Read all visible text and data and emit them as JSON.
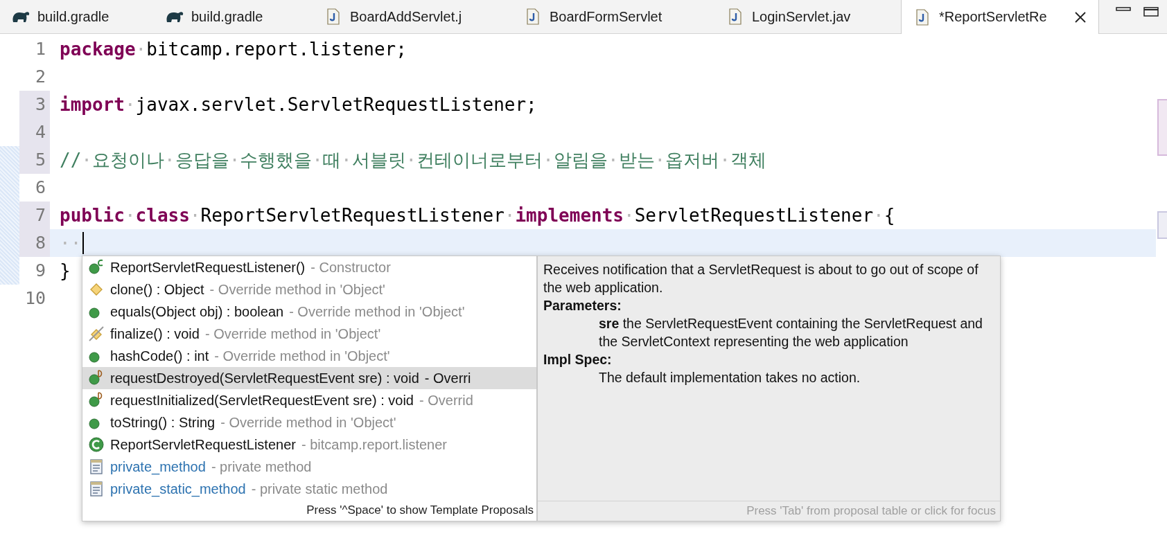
{
  "tabs": [
    {
      "label": "build.gradle",
      "kind": "gradle",
      "selected": false
    },
    {
      "label": "build.gradle",
      "kind": "gradle",
      "selected": false
    },
    {
      "label": "BoardAddServlet.j",
      "kind": "java",
      "selected": false
    },
    {
      "label": "BoardFormServlet",
      "kind": "java",
      "selected": false
    },
    {
      "label": "LoginServlet.jav",
      "kind": "java",
      "selected": false
    },
    {
      "label": "*ReportServletRe",
      "kind": "java",
      "selected": true
    }
  ],
  "editor": {
    "lines": [
      {
        "number": "1",
        "changed": false,
        "tokens": [
          {
            "kind": "keyword",
            "text": "package"
          },
          {
            "kind": "space",
            "text": "·"
          },
          {
            "kind": "plain",
            "text": "bitcamp.report.listener;"
          }
        ]
      },
      {
        "number": "2",
        "changed": false
      },
      {
        "number": "3",
        "changed": true,
        "tokens": [
          {
            "kind": "keyword",
            "text": "import"
          },
          {
            "kind": "space",
            "text": "·"
          },
          {
            "kind": "plain",
            "text": "javax.servlet.ServletRequestListener;"
          }
        ]
      },
      {
        "number": "4",
        "changed": true
      },
      {
        "number": "5",
        "changed": true,
        "tokens": [
          {
            "kind": "comment",
            "text": "//"
          },
          {
            "kind": "space",
            "text": "·"
          },
          {
            "kind": "comment",
            "text": "요청이나"
          },
          {
            "kind": "space",
            "text": "·"
          },
          {
            "kind": "comment",
            "text": "응답을"
          },
          {
            "kind": "space",
            "text": "·"
          },
          {
            "kind": "comment",
            "text": "수행했을"
          },
          {
            "kind": "space",
            "text": "·"
          },
          {
            "kind": "comment",
            "text": "때"
          },
          {
            "kind": "space",
            "text": "·"
          },
          {
            "kind": "comment",
            "text": "서블릿"
          },
          {
            "kind": "space",
            "text": "·"
          },
          {
            "kind": "comment",
            "text": "컨테이너로부터"
          },
          {
            "kind": "space",
            "text": "·"
          },
          {
            "kind": "comment",
            "text": "알림을"
          },
          {
            "kind": "space",
            "text": "·"
          },
          {
            "kind": "comment",
            "text": "받는"
          },
          {
            "kind": "space",
            "text": "·"
          },
          {
            "kind": "comment",
            "text": "옵저버"
          },
          {
            "kind": "space",
            "text": "·"
          },
          {
            "kind": "comment",
            "text": "객체"
          }
        ]
      },
      {
        "number": "6",
        "changed": false
      },
      {
        "number": "7",
        "changed": true,
        "tokens": [
          {
            "kind": "keyword",
            "text": "public"
          },
          {
            "kind": "space",
            "text": "·"
          },
          {
            "kind": "keyword",
            "text": "class"
          },
          {
            "kind": "space",
            "text": "·"
          },
          {
            "kind": "plain",
            "text": "ReportServletRequestListener"
          },
          {
            "kind": "space",
            "text": "·"
          },
          {
            "kind": "keyword",
            "text": "implements"
          },
          {
            "kind": "space",
            "text": "·"
          },
          {
            "kind": "plain",
            "text": "ServletRequestListener"
          },
          {
            "kind": "space",
            "text": "·"
          },
          {
            "kind": "plain",
            "text": "{"
          }
        ]
      },
      {
        "number": "8",
        "changed": true,
        "current": true,
        "tokens": [
          {
            "kind": "space",
            "text": "··"
          }
        ]
      },
      {
        "number": "9",
        "changed": false,
        "tokens": [
          {
            "kind": "plain",
            "text": "}"
          }
        ]
      },
      {
        "number": "10",
        "changed": false
      }
    ]
  },
  "completion": {
    "proposals": [
      {
        "kind": "constructor",
        "name": "ReportServletRequestListener()",
        "detail": "- Constructor",
        "selected": false
      },
      {
        "kind": "default",
        "name": "clone() : Object",
        "detail": "- Override method in 'Object'",
        "selected": false
      },
      {
        "kind": "method",
        "name": "equals(Object obj) : boolean",
        "detail": "- Override method in 'Object'",
        "selected": false
      },
      {
        "kind": "deprecated",
        "name": "finalize() : void",
        "detail": "- Override method in 'Object'",
        "selected": false
      },
      {
        "kind": "method",
        "name": "hashCode() : int",
        "detail": "- Override method in 'Object'",
        "selected": false
      },
      {
        "kind": "default-method",
        "name": "requestDestroyed(ServletRequestEvent sre) : void",
        "detail": "- Overri",
        "selected": true
      },
      {
        "kind": "default-method",
        "name": "requestInitialized(ServletRequestEvent sre) : void",
        "detail": "- Overrid",
        "selected": false
      },
      {
        "kind": "method",
        "name": "toString() : String",
        "detail": "- Override method in 'Object'",
        "selected": false
      },
      {
        "kind": "class",
        "name": "ReportServletRequestListener",
        "detail": "- bitcamp.report.listener",
        "selected": false
      },
      {
        "kind": "template",
        "name": "private_method",
        "detail": "- private method",
        "selected": false
      },
      {
        "kind": "template",
        "name": "private_static_method",
        "detail": "- private static method",
        "selected": false
      }
    ],
    "footer": "Press '^Space' to show Template Proposals",
    "doc": {
      "summary": "Receives notification that a ServletRequest is about to go out of scope of the web application.",
      "sections": [
        {
          "heading": "Parameters:",
          "text": "**sre** the ServletRequestEvent containing the ServletRequest and the ServletContext representing the web application"
        },
        {
          "heading": "Impl Spec:",
          "text": "The default implementation takes no action."
        }
      ],
      "footer": "Press 'Tab' from proposal table or click for focus"
    }
  }
}
